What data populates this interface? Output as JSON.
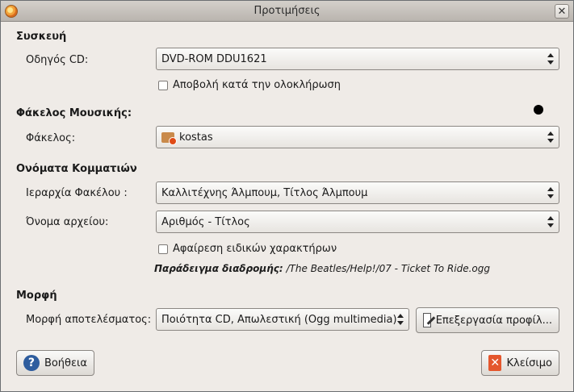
{
  "window": {
    "title": "Προτιμήσεις",
    "close_glyph": "✕"
  },
  "device": {
    "section_title": "Συσκευή",
    "cd_label": "Οδηγός CD:",
    "cd_value": "DVD-ROM DDU1621",
    "eject_label": "Αποβολή κατά την ολοκλήρωση"
  },
  "music_folder": {
    "section_title": "Φάκελος Μουσικής:",
    "folder_label": "Φάκελος:",
    "folder_value": "kostas"
  },
  "track_names": {
    "section_title": "Ονόματα Κομματιών",
    "hierarchy_label": "Ιεραρχία Φακέλου :",
    "hierarchy_value": "Καλλιτέχνης Άλμπουμ, Τίτλος Άλμπουμ",
    "filename_label": "Όνομα αρχείου:",
    "filename_value": "Αριθμός - Τίτλος",
    "strip_label": "Αφαίρεση ειδικών χαρακτήρων",
    "example_label": "Παράδειγμα διαδρομής:",
    "example_path": "/The Beatles/Help!/07 - Ticket To Ride.ogg"
  },
  "format": {
    "section_title": "Μορφή",
    "output_label": "Μορφή αποτελέσματος:",
    "output_value": "Ποιότητα CD, Απωλεστική (Ogg multimedia)",
    "edit_profiles_label": "Επεξεργασία προφίλ..."
  },
  "footer": {
    "help_label": "Βοήθεια",
    "close_label": "Κλείσιμο"
  }
}
